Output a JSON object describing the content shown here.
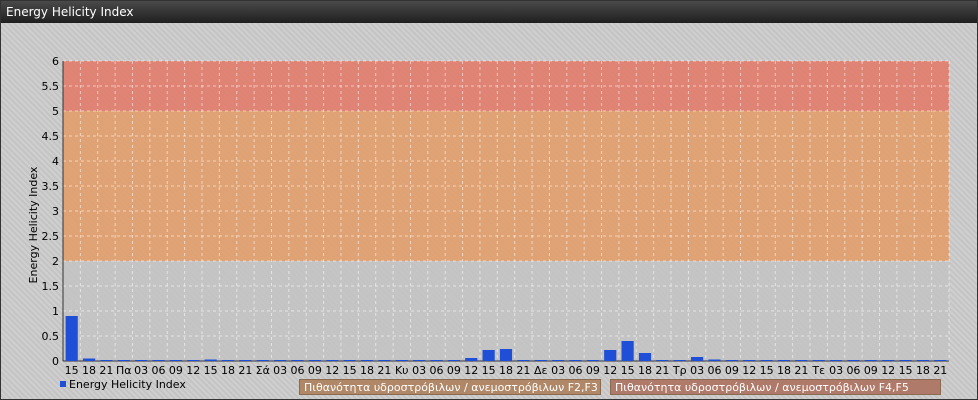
{
  "window": {
    "title": "Energy Helicity Index"
  },
  "chart_data": {
    "type": "bar",
    "ylabel": "Energy Helicity Index",
    "xlabel": "",
    "ylim": [
      0,
      6
    ],
    "yticks": [
      "0",
      "0.5",
      "1",
      "1.5",
      "2",
      "2.5",
      "3",
      "3.5",
      "4",
      "4.5",
      "5",
      "5.5",
      "6"
    ],
    "grid": true,
    "categories": [
      "15",
      "18",
      "21",
      "Πα",
      "03",
      "06",
      "09",
      "12",
      "15",
      "18",
      "21",
      "Σά",
      "03",
      "06",
      "09",
      "12",
      "15",
      "18",
      "21",
      "Κυ",
      "03",
      "06",
      "09",
      "12",
      "15",
      "18",
      "21",
      "Δε",
      "03",
      "06",
      "09",
      "12",
      "15",
      "18",
      "21",
      "Τρ",
      "03",
      "06",
      "09",
      "12",
      "15",
      "18",
      "21",
      "Τε",
      "03",
      "06",
      "09",
      "12",
      "15",
      "18",
      "21"
    ],
    "series": [
      {
        "name": "Energy Helicity Index",
        "color": "#1e4fd6",
        "values": [
          0.9,
          0.05,
          0.02,
          0.02,
          0.02,
          0.02,
          0.02,
          0.02,
          0.03,
          0.02,
          0.02,
          0.02,
          0.02,
          0.02,
          0.02,
          0.02,
          0.02,
          0.02,
          0.02,
          0.02,
          0.02,
          0.02,
          0.02,
          0.06,
          0.22,
          0.24,
          0.02,
          0.02,
          0.02,
          0.02,
          0.02,
          0.22,
          0.4,
          0.16,
          0.02,
          0.02,
          0.08,
          0.03,
          0.02,
          0.02,
          0.02,
          0.02,
          0.02,
          0.02,
          0.02,
          0.02,
          0.02,
          0.02,
          0.02,
          0.02,
          0.02
        ]
      }
    ],
    "zones": [
      {
        "from": 2,
        "to": 5,
        "color": "#e0a070",
        "label": "Πιθανότητα υδροστρόβιλων / ανεμοστρόβιλων F2,F3"
      },
      {
        "from": 5,
        "to": 6,
        "color": "#e08070",
        "label": "Πιθανότητα υδροστρόβιλων / ανεμοστρόβιλων F4,F5"
      }
    ],
    "legend_position": "bottom"
  }
}
